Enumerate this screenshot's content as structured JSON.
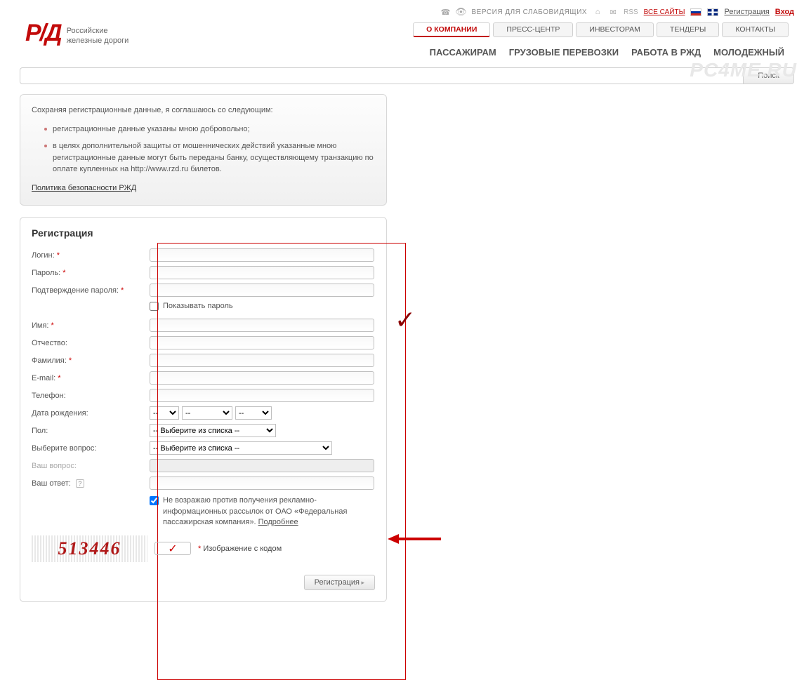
{
  "topbar": {
    "accessibility": "ВЕРСИЯ ДЛЯ СЛАБОВИДЯЩИХ",
    "rss": "RSS",
    "all_sites": "ВСЕ САЙТЫ",
    "register": "Регистрация",
    "login": "Вход"
  },
  "logo": {
    "mark": "Р/Д",
    "line1": "Российские",
    "line2": "железные дороги"
  },
  "nav1": {
    "about": "О КОМПАНИИ",
    "press": "ПРЕСС-ЦЕНТР",
    "investors": "ИНВЕСТОРАМ",
    "tenders": "ТЕНДЕРЫ",
    "contacts": "КОНТАКТЫ"
  },
  "nav2": {
    "passengers": "ПАССАЖИРАМ",
    "cargo": "ГРУЗОВЫЕ ПЕРЕВОЗКИ",
    "jobs": "РАБОТА В РЖД",
    "youth": "МОЛОДЕЖНЫЙ"
  },
  "search": {
    "button": "Поиск"
  },
  "panel": {
    "intro": "Сохраняя регистрационные данные, я соглашаюсь со следующим:",
    "b1": "регистрационные данные указаны мною добровольно;",
    "b2": "в целях дополнительной защиты от мошеннических действий указанные мною регистрационные данные могут быть переданы банку, осуществляющему транзакцию по оплате купленных на http://www.rzd.ru билетов.",
    "policy": "Политика безопасности РЖД"
  },
  "form": {
    "title": "Регистрация",
    "login": "Логин:",
    "password": "Пароль:",
    "password2": "Подтверждение пароля:",
    "showpass": "Показывать пароль",
    "firstname": "Имя:",
    "middlename": "Отчество:",
    "lastname": "Фамилия:",
    "email": "E-mail:",
    "phone": "Телефон:",
    "dob": "Дата рождения:",
    "gender": "Пол:",
    "question": "Выберите вопрос:",
    "your_q": "Ваш вопрос:",
    "your_a": "Ваш ответ:",
    "select_placeholder": "-- Выберите из списка --",
    "dd": "--",
    "consent": "Не возражаю против получения рекламно-информационных рассылок от ОАО «Федеральная пассажирская компания».",
    "more": "Подробнее",
    "captcha_label": "Изображение с кодом",
    "captcha_text": "513446",
    "submit": "Регистрация"
  },
  "watermark": "PC4ME.RU"
}
